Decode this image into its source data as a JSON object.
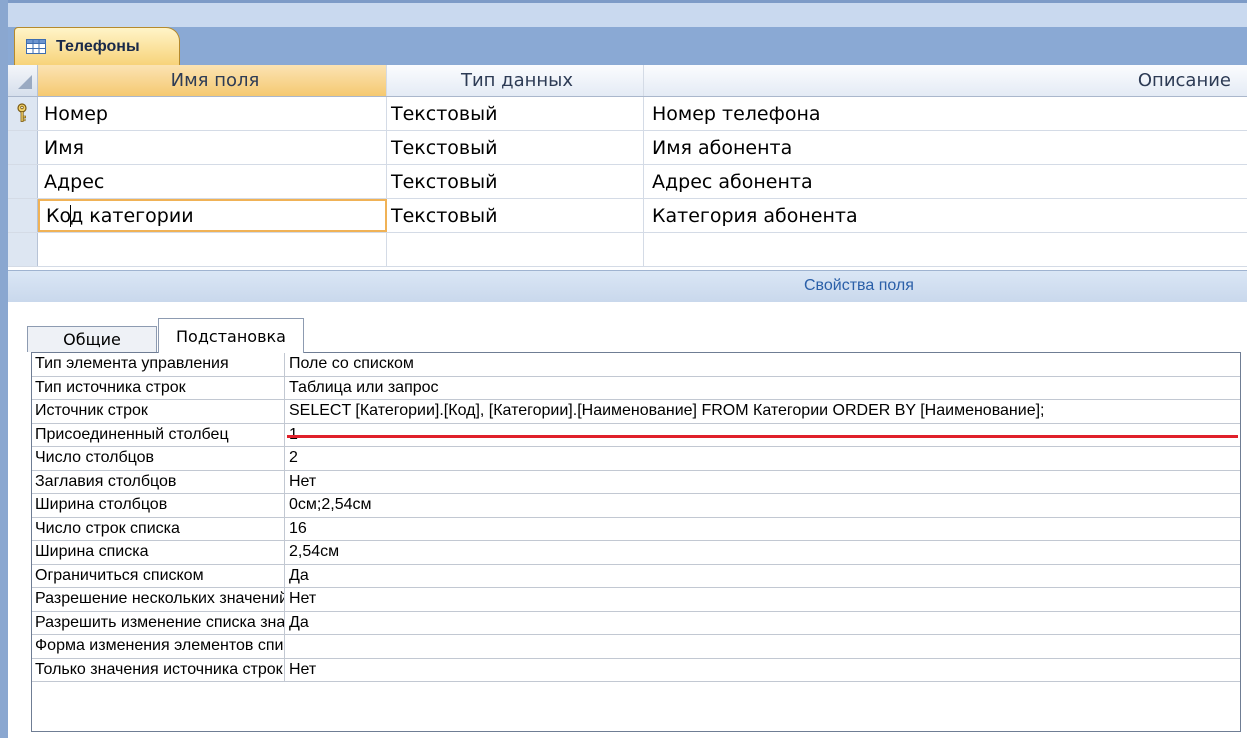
{
  "document_tab": {
    "title": "Телефоны",
    "icon": "table-icon"
  },
  "design_grid": {
    "headers": [
      "Имя поля",
      "Тип данных",
      "Описание"
    ],
    "rows": [
      {
        "field": "Номер",
        "type": "Текстовый",
        "description": "Номер телефона",
        "primary_key": true
      },
      {
        "field": "Имя",
        "type": "Текстовый",
        "description": "Имя  абонента",
        "primary_key": false
      },
      {
        "field": "Адрес",
        "type": "Текстовый",
        "description": "Адрес абонента",
        "primary_key": false
      },
      {
        "field_before_caret": "Ко",
        "field_after_caret": "д категории",
        "type": "Текстовый",
        "description": "Категория абонента",
        "primary_key": false
      }
    ]
  },
  "field_properties": {
    "title": "Свойства поля",
    "tabs": [
      "Общие",
      "Подстановка"
    ],
    "active_tab": "Подстановка",
    "properties": [
      {
        "label": "Тип элемента управления",
        "value": "Поле со списком"
      },
      {
        "label": "Тип источника строк",
        "value": "Таблица или запрос"
      },
      {
        "label": "Источник строк",
        "value": "SELECT [Категории].[Код], [Категории].[Наименование] FROM Категории ORDER BY [Наименование];"
      },
      {
        "label": "Присоединенный столбец",
        "value": "1"
      },
      {
        "label": "Число столбцов",
        "value": "2"
      },
      {
        "label": "Заглавия столбцов",
        "value": "Нет"
      },
      {
        "label": "Ширина столбцов",
        "value": "0см;2,54см"
      },
      {
        "label": "Число строк списка",
        "value": "16"
      },
      {
        "label": "Ширина списка",
        "value": "2,54см"
      },
      {
        "label": "Ограничиться списком",
        "value": "Да"
      },
      {
        "label": "Разрешение нескольких значений",
        "value": "Нет"
      },
      {
        "label": "Разрешить изменение списка значений",
        "value": "Да"
      },
      {
        "label": "Форма изменения элементов списка",
        "value": ""
      },
      {
        "label": "Только значения источника строк",
        "value": "Нет"
      }
    ]
  },
  "colors": {
    "highlight_underline": "#e0202a",
    "active_accent": "#f0b256",
    "title_blue": "#2a5fa8"
  }
}
